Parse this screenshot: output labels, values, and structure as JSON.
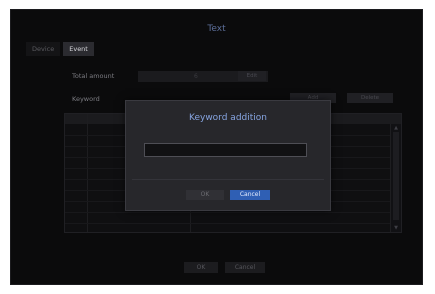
{
  "window": {
    "title": "Text"
  },
  "tabs": [
    {
      "label": "Device",
      "active": false
    },
    {
      "label": "Event",
      "active": true
    }
  ],
  "fields": {
    "total_amount_label": "Total amount",
    "total_amount_value": "6",
    "total_amount_button": "Edit",
    "keyword_label": "Keyword",
    "add_button": "Add",
    "delete_button": "Delete"
  },
  "footer": {
    "ok_label": "OK",
    "cancel_label": "Cancel"
  },
  "modal": {
    "title": "Keyword addition",
    "input_value": "",
    "ok_label": "OK",
    "cancel_label": "Cancel"
  },
  "colors": {
    "accent_title": "#5d6f9a",
    "modal_title": "#86a4e0",
    "primary_button": "#2f5fb4"
  }
}
